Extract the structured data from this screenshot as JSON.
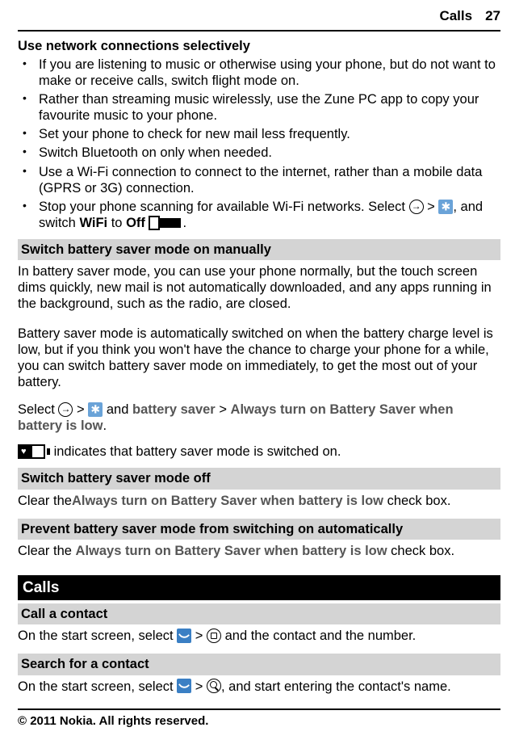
{
  "header": {
    "section": "Calls",
    "page": "27"
  },
  "net": {
    "title": "Use network connections selectively",
    "items": [
      "If you are listening to music or otherwise using your phone, but do not want to make or receive calls, switch flight mode on.",
      "Rather than streaming music wirelessly, use the Zune PC app to copy your favourite music to your phone.",
      "Set your phone to check for new mail less frequently.",
      "Switch Bluetooth on only when needed.",
      "Use a Wi-Fi connection to connect to the internet, rather than a mobile data (GPRS or 3G) connection."
    ],
    "last": {
      "pre": "Stop your phone scanning for available Wi-Fi networks. Select ",
      "gt": " > ",
      "mid": ", and switch ",
      "wifi": "WiFi",
      "to": " to ",
      "off": "Off",
      "end": "."
    }
  },
  "saver_on": {
    "title": "Switch battery saver mode on manually",
    "p1": "In battery saver mode, you can use your phone normally, but the touch screen dims quickly, new mail is not automatically downloaded, and any apps running in the background, such as the radio, are closed.",
    "p2": "Battery saver mode is automatically switched on when the battery charge level is low, but if you think you won't have the chance to charge your phone for a while, you can switch battery saver mode on immediately, to get the most out of your battery.",
    "sel": {
      "pre": "Select ",
      "gt": " > ",
      "and": " and ",
      "bs": "battery saver",
      "gt2": " > ",
      "opt": "Always turn on Battery Saver when battery is low",
      "end": "."
    },
    "ind": " indicates that battery saver mode is switched on."
  },
  "saver_off": {
    "title": "Switch battery saver mode off",
    "pre": "Clear the",
    "opt": "Always turn on Battery Saver when battery is low",
    "post": " check box."
  },
  "prevent": {
    "title": "Prevent battery saver mode from switching on automatically",
    "pre": "Clear the ",
    "opt": "Always turn on Battery Saver when battery is low",
    "post": " check box."
  },
  "calls": {
    "title": "Calls",
    "call": {
      "title": "Call a contact",
      "pre": "On the start screen, select ",
      "gt": " > ",
      "post": " and the contact and the number."
    },
    "search": {
      "title": "Search for a contact",
      "pre": "On the start screen, select ",
      "gt": " > ",
      "post": ", and start entering the contact's name."
    }
  },
  "footer": "© 2011 Nokia. All rights reserved."
}
